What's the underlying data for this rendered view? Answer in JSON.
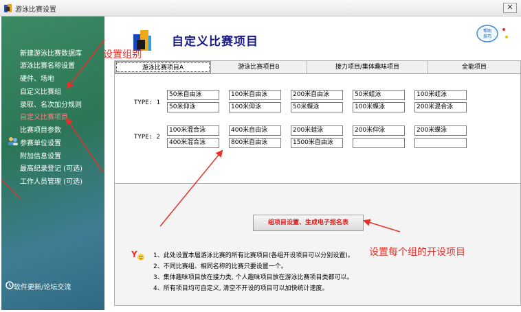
{
  "window": {
    "title": "游泳比赛设置",
    "close_label": "✕"
  },
  "sidebar": {
    "items": [
      {
        "label": "新建游泳比赛数据库"
      },
      {
        "label": "游泳比赛名称设置"
      },
      {
        "label": "硬件、场地"
      },
      {
        "label": "自定义比赛组"
      },
      {
        "label": "录取、名次加分规则"
      },
      {
        "label": "自定义比赛项目",
        "active": true
      },
      {
        "label": "比赛项目参数"
      },
      {
        "label": "参赛单位设置"
      },
      {
        "label": "附加信息设置"
      },
      {
        "label": "最高纪录登记 (可选)"
      },
      {
        "label": "工作人员管理 (可选)"
      }
    ],
    "footer": "软件更新/论坛交流"
  },
  "header": {
    "title": "自定义比赛项目",
    "help_label": "帮助技巧"
  },
  "tabs": [
    "游泳比赛项目A",
    "游泳比赛项目B",
    "接力项目/集体趣味项目",
    "全能项目"
  ],
  "types": [
    {
      "label": "TYPE: 1",
      "rows": [
        [
          "50米自由泳",
          "100米自由泳",
          "200米自由泳",
          "50米蛙泳",
          "100米蛙泳"
        ],
        [
          "50米仰泳",
          "100米仰泳",
          "50米蝶泳",
          "100米蝶泳",
          "200米混合泳"
        ]
      ]
    },
    {
      "label": "TYPE: 2",
      "rows": [
        [
          "100米混合泳",
          "400米自由泳",
          "200米蛙泳",
          "200米仰泳",
          "200米蝶泳"
        ],
        [
          "400米混合泳",
          "800米自由泳",
          "1500米自由泳",
          "",
          ""
        ]
      ]
    }
  ],
  "generate_button": "组项目设置、生成电子报名表",
  "notes": [
    "1、此处设置本届游泳比赛的所有比赛项目(各组开设项目可以分别设置)。",
    "2、不同比赛组、相同名称的比赛只要设置一个。",
    "3、集体趣味项目放在接力类, 个人趣味项目放在游泳比赛项目类都可以。",
    "4、所有项目均可自定义, 清空不开设的项目可以加快统计速度。"
  ],
  "annotations": {
    "group": "设置组别",
    "items": "设置每个组的开设项目"
  },
  "colors": {
    "accent_title": "#1a1a8c",
    "annotation": "#e8302a",
    "active_menu": "#ff8080",
    "sidebar": "#2c7656"
  }
}
